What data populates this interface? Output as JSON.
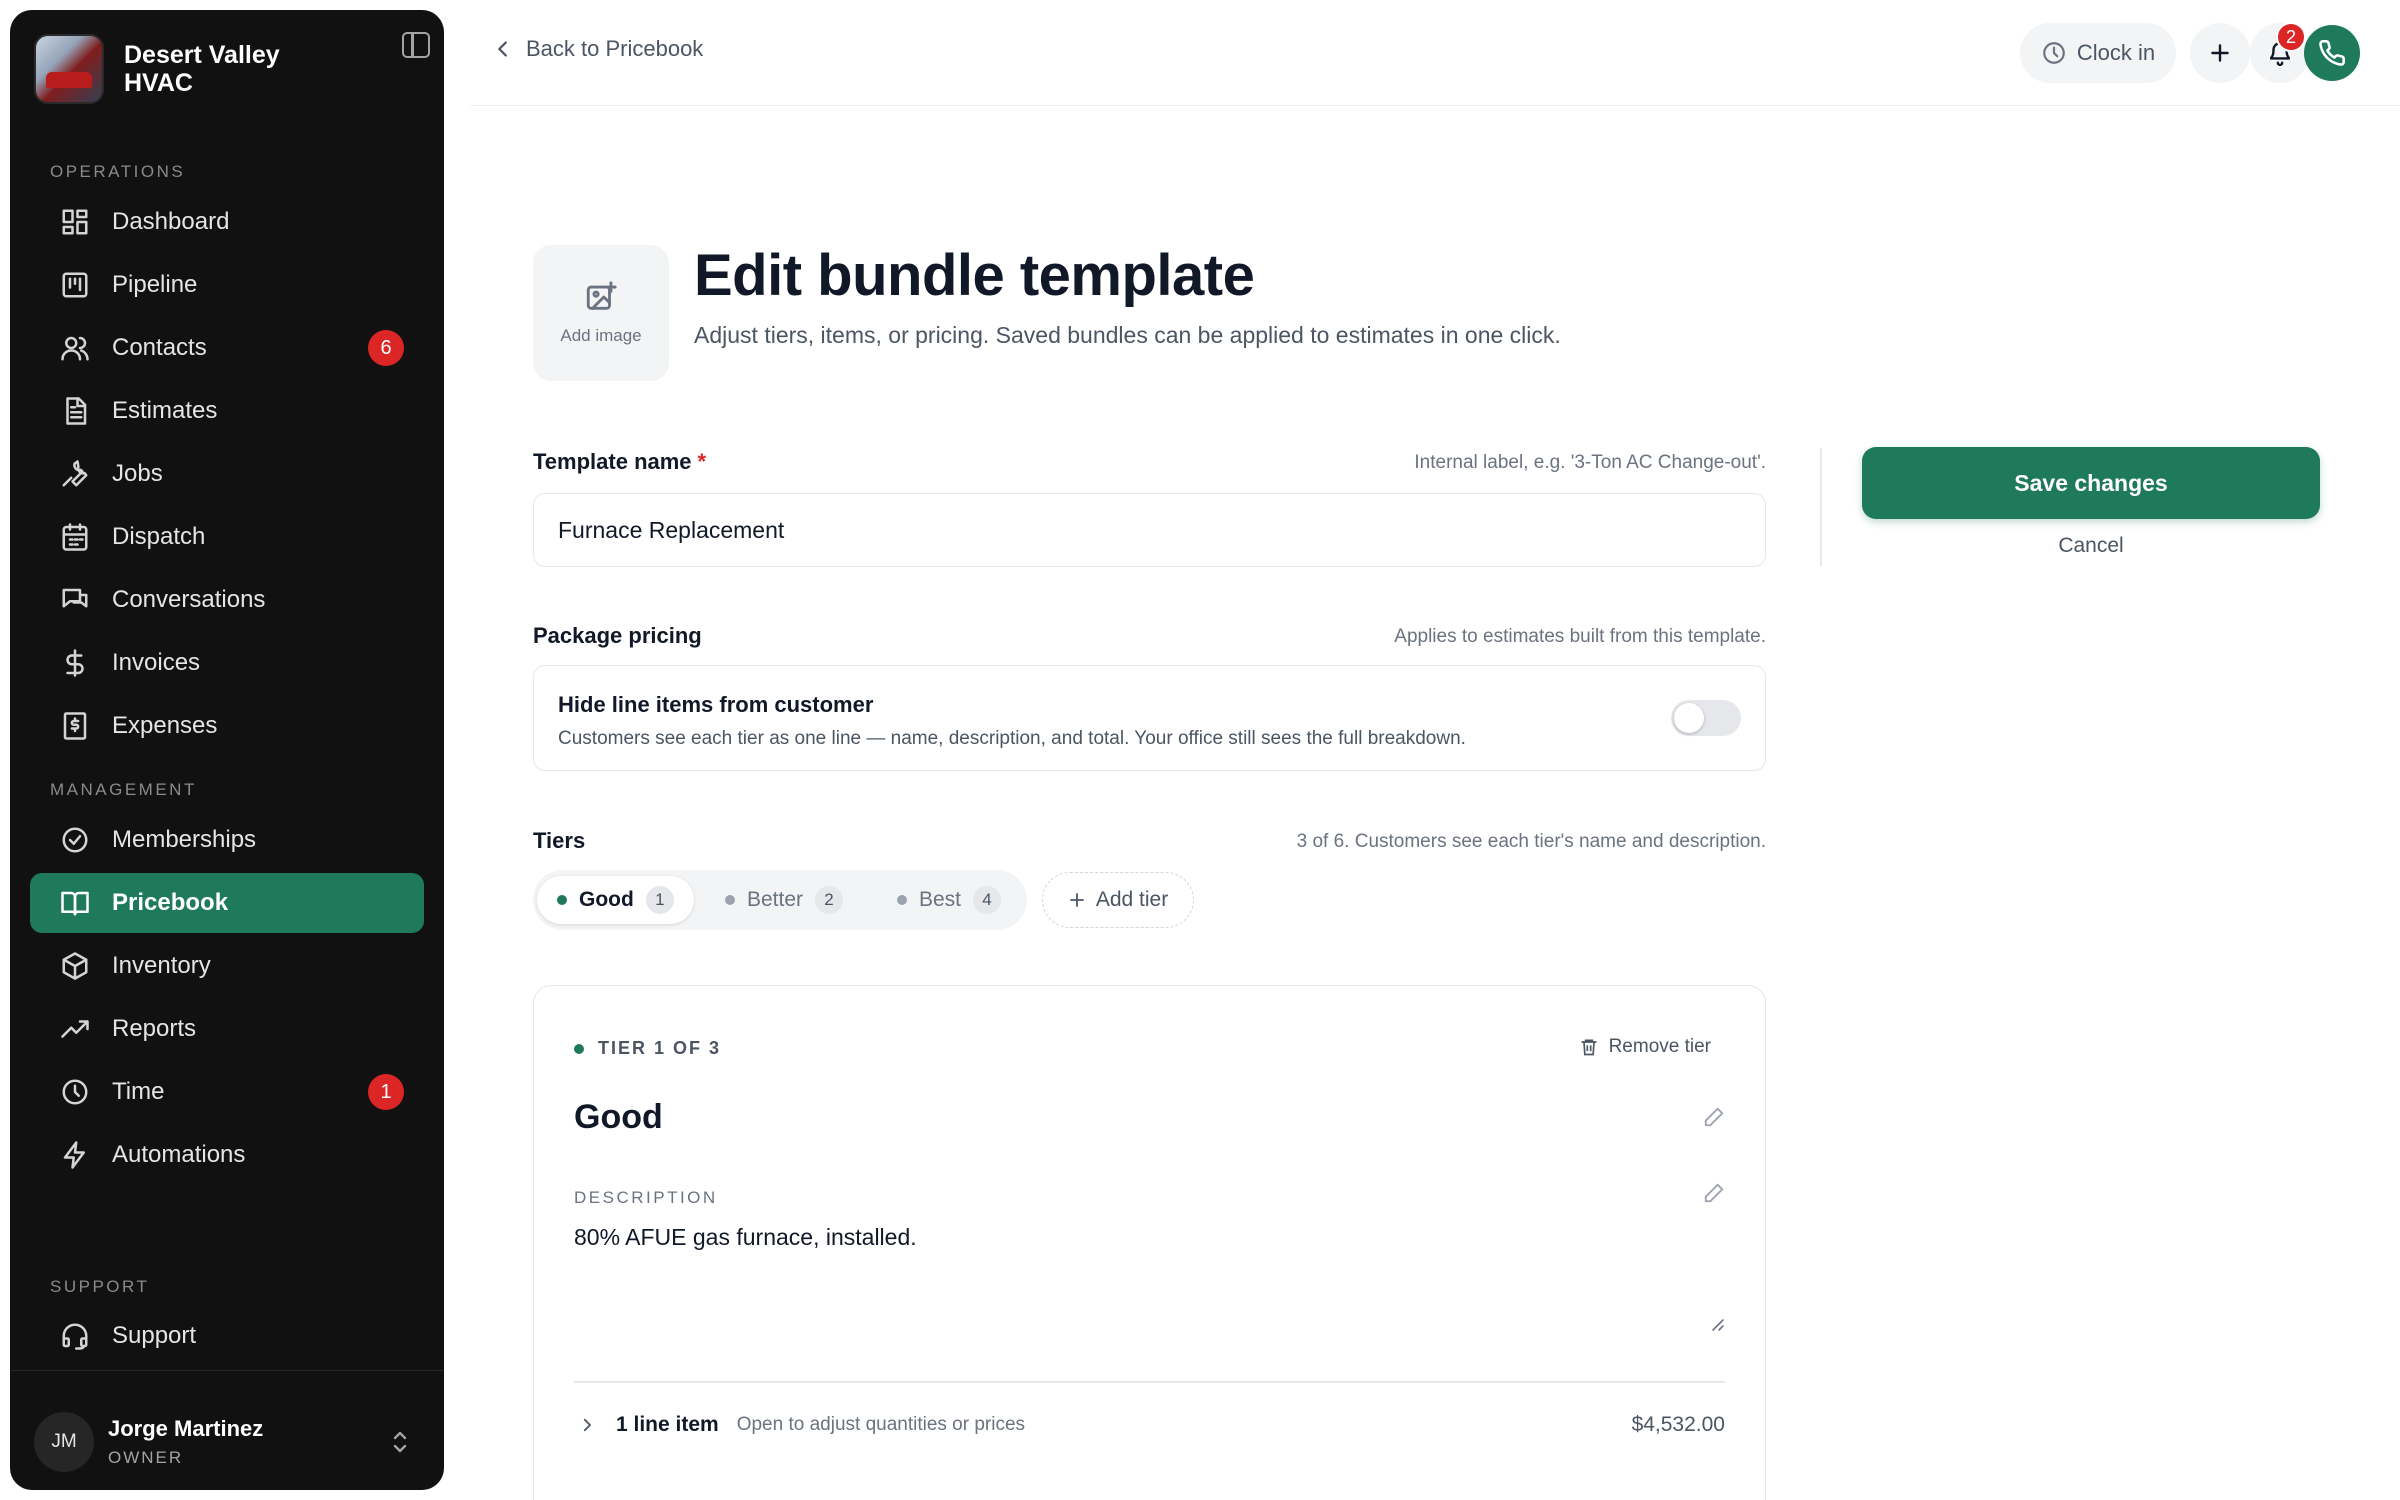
{
  "brand": {
    "name": "Desert Valley HVAC"
  },
  "sidebar": {
    "sections": {
      "operations": "OPERATIONS",
      "management": "MANAGEMENT",
      "support": "SUPPORT"
    },
    "items": [
      {
        "label": "Dashboard",
        "icon": "dashboard-icon"
      },
      {
        "label": "Pipeline",
        "icon": "pipeline-icon"
      },
      {
        "label": "Contacts",
        "icon": "contacts-icon",
        "badge": "6"
      },
      {
        "label": "Estimates",
        "icon": "estimates-icon"
      },
      {
        "label": "Jobs",
        "icon": "wrench-icon"
      },
      {
        "label": "Dispatch",
        "icon": "calendar-icon"
      },
      {
        "label": "Conversations",
        "icon": "chat-icon"
      },
      {
        "label": "Invoices",
        "icon": "dollar-icon"
      },
      {
        "label": "Expenses",
        "icon": "receipt-icon"
      },
      {
        "label": "Memberships",
        "icon": "badge-check-icon"
      },
      {
        "label": "Pricebook",
        "icon": "book-icon",
        "active": true
      },
      {
        "label": "Inventory",
        "icon": "box-icon"
      },
      {
        "label": "Reports",
        "icon": "trend-icon"
      },
      {
        "label": "Time",
        "icon": "clock-icon",
        "badge": "1"
      },
      {
        "label": "Automations",
        "icon": "bolt-icon"
      },
      {
        "label": "Support",
        "icon": "headset-icon"
      }
    ],
    "user": {
      "initials": "JM",
      "name": "Jorge Martinez",
      "role": "OWNER"
    }
  },
  "topbar": {
    "back_label": "Back to Pricebook",
    "clock_label": "Clock in",
    "notification_count": "2"
  },
  "header": {
    "add_image_label": "Add image",
    "title": "Edit bundle template",
    "subtitle": "Adjust tiers, items, or pricing. Saved bundles can be applied to estimates in one click."
  },
  "form": {
    "template_name_label": "Template name",
    "required_mark": "*",
    "template_name_hint": "Internal label, e.g. '3-Ton AC Change-out'.",
    "template_name_value": "Furnace Replacement",
    "package_pricing_label": "Package pricing",
    "package_pricing_hint": "Applies to estimates built from this template.",
    "hide_items_title": "Hide line items from customer",
    "hide_items_desc": "Customers see each tier as one line — name, description, and total. Your office still sees the full breakdown.",
    "hide_items_enabled": false,
    "tiers_label": "Tiers",
    "tiers_hint": "3 of 6. Customers see each tier's name and description."
  },
  "tiers": [
    {
      "name": "Good",
      "count": "1",
      "active": true
    },
    {
      "name": "Better",
      "count": "2"
    },
    {
      "name": "Best",
      "count": "4"
    }
  ],
  "add_tier_label": "Add tier",
  "tier_card": {
    "eyebrow": "TIER 1 OF 3",
    "remove_label": "Remove tier",
    "name": "Good",
    "description_label": "DESCRIPTION",
    "description": "80% AFUE gas furnace, installed.",
    "line_count": "1 line item",
    "line_hint": "Open to adjust quantities or prices",
    "line_total": "$4,532.00"
  },
  "actions": {
    "save_label": "Save changes",
    "cancel_label": "Cancel"
  },
  "colors": {
    "accent": "#1f7a5c",
    "sidebar_bg": "#111111",
    "badge": "#dc2626"
  }
}
